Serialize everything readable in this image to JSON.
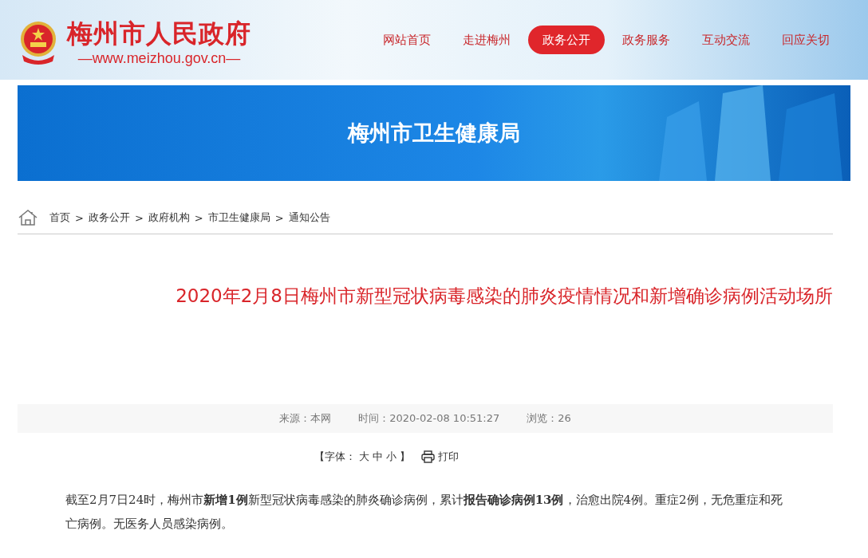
{
  "site": {
    "title": "梅州市人民政府",
    "url": "—www.meizhou.gov.cn—"
  },
  "nav": [
    {
      "label": "网站首页",
      "selected": false
    },
    {
      "label": "走进梅州",
      "selected": false
    },
    {
      "label": "政务公开",
      "selected": true
    },
    {
      "label": "政务服务",
      "selected": false
    },
    {
      "label": "互动交流",
      "selected": false
    },
    {
      "label": "回应关切",
      "selected": false
    }
  ],
  "banner": {
    "title": "梅州市卫生健康局"
  },
  "breadcrumb": {
    "items": [
      "首页",
      "政务公开",
      "政府机构",
      "市卫生健康局",
      "通知公告"
    ],
    "separator": ">"
  },
  "article": {
    "title": "2020年2月8日梅州市新型冠状病毒感染的肺炎疫情情况和新增确诊病例活动场所",
    "meta": [
      "来源：本网",
      "时间：2020-02-08 10:51:27",
      "浏览：26"
    ],
    "font_label": "【字体：",
    "font_sizes": [
      "大",
      "中",
      "小"
    ],
    "font_close": "】",
    "print": "打印",
    "body": "截至2月7日24时，梅州市**新增1例**新型冠状病毒感染的肺炎确诊病例，累计**报告确诊病例13例**，治愈出院4例。重症2例，无危重症和死亡病例。无医务人员感染病例。"
  }
}
